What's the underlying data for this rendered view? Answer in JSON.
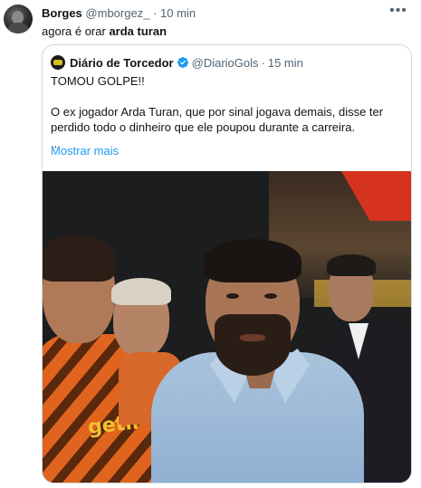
{
  "tweet": {
    "author_name": "Borges",
    "handle": "@mborgez_",
    "separator": "·",
    "time": "10 min",
    "text_prefix": "agora é orar ",
    "text_bold": "arda turan"
  },
  "quoted": {
    "author_name": "Diário de Torcedor",
    "handle": "@DiarioGols",
    "separator": "·",
    "time": "15 min",
    "line1": "TOMOU GOLPE!!",
    "line2": "O ex jogador Arda Turan, que por sinal jogava demais, disse ter perdido todo o dinheiro que ele poupou durante a carreira.",
    "line3": "...",
    "show_more": "Mostrar mais"
  },
  "photo": {
    "jersey_text": "getir"
  },
  "colors": {
    "link": "#1d9bf0",
    "muted": "#536471",
    "border": "#cfd9de",
    "verified": "#1d9bf0"
  },
  "icons": {
    "more": "more-horizontal-icon",
    "verified": "verified-badge-icon"
  }
}
